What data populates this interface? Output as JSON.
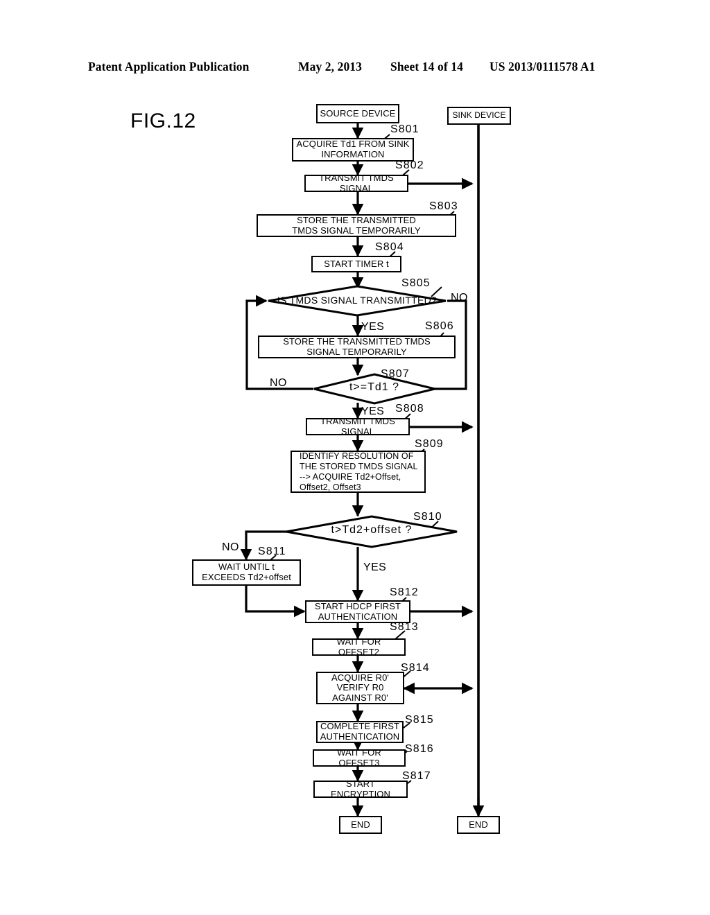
{
  "header": {
    "publication": "Patent Application Publication",
    "date": "May 2, 2013",
    "sheet": "Sheet 14 of 14",
    "number": "US 2013/0111578 A1"
  },
  "figure": {
    "label": "FIG.12"
  },
  "lanes": {
    "source": "SOURCE DEVICE",
    "sink": "SINK DEVICE"
  },
  "nodes": {
    "s801": "ACQUIRE Td1 FROM SINK\nINFORMATION",
    "s802": "TRANSMIT TMDS SIGNAL",
    "s803": "STORE THE TRANSMITTED\nTMDS SIGNAL TEMPORARILY",
    "s804": "START TIMER t",
    "s805": "IS TMDS SIGNAL TRANSMITTED?",
    "s806": "STORE THE TRANSMITTED TMDS\nSIGNAL TEMPORARILY",
    "s807": "t>=Td1 ?",
    "s808": "TRANSMIT TMDS SIGNAL",
    "s809": "IDENTIFY RESOLUTION OF\nTHE STORED TMDS SIGNAL\n--> ACQUIRE Td2+Offset,\nOffset2, Offset3",
    "s810": "t>Td2+offset ?",
    "s811": "WAIT UNTIL t\nEXCEEDS Td2+offset",
    "s812": "START HDCP FIRST\nAUTHENTICATION",
    "s813": "WAIT FOR OFFSET2",
    "s814": "ACQUIRE R0'\nVERIFY R0\nAGAINST R0'",
    "s815": "COMPLETE FIRST\nAUTHENTICATION",
    "s816": "WAIT FOR OFFSET3",
    "s817": "START ENCRYPTION",
    "end_source": "END",
    "end_sink": "END"
  },
  "step_refs": {
    "s801": "S801",
    "s802": "S802",
    "s803": "S803",
    "s804": "S804",
    "s805": "S805",
    "s806": "S806",
    "s807": "S807",
    "s808": "S808",
    "s809": "S809",
    "s810": "S810",
    "s811": "S811",
    "s812": "S812",
    "s813": "S813",
    "s814": "S814",
    "s815": "S815",
    "s816": "S816",
    "s817": "S817"
  },
  "branches": {
    "s805_no": "NO",
    "s805_yes": "YES",
    "s807_no": "NO",
    "s807_yes": "YES",
    "s810_no": "NO",
    "s810_yes": "YES"
  },
  "colors": {
    "ink": "#000000",
    "paper": "#ffffff"
  }
}
